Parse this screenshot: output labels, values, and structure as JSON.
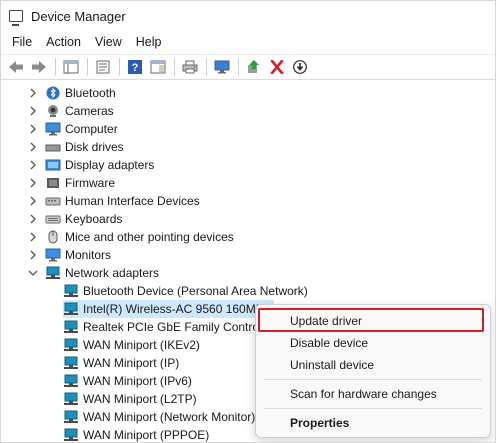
{
  "window": {
    "title": "Device Manager"
  },
  "menubar": {
    "items": [
      "File",
      "Action",
      "View",
      "Help"
    ]
  },
  "toolbar": {
    "buttons": [
      "back-arrow-icon",
      "forward-arrow-icon",
      "show-hide-tree-icon",
      "properties-icon",
      "help-icon",
      "action-pane-icon",
      "print-icon",
      "computer-monitor-icon",
      "update-driver-icon",
      "uninstall-x-icon",
      "download-icon"
    ]
  },
  "tree": {
    "categories": [
      {
        "label": "Bluetooth",
        "icon": "bluetooth-icon",
        "expanded": false
      },
      {
        "label": "Cameras",
        "icon": "camera-icon",
        "expanded": false
      },
      {
        "label": "Computer",
        "icon": "computer-icon",
        "expanded": false
      },
      {
        "label": "Disk drives",
        "icon": "disk-drive-icon",
        "expanded": false
      },
      {
        "label": "Display adapters",
        "icon": "display-adapter-icon",
        "expanded": false
      },
      {
        "label": "Firmware",
        "icon": "firmware-icon",
        "expanded": false
      },
      {
        "label": "Human Interface Devices",
        "icon": "hid-icon",
        "expanded": false
      },
      {
        "label": "Keyboards",
        "icon": "keyboard-icon",
        "expanded": false
      },
      {
        "label": "Mice and other pointing devices",
        "icon": "mouse-icon",
        "expanded": false
      },
      {
        "label": "Monitors",
        "icon": "monitor-icon",
        "expanded": false
      },
      {
        "label": "Network adapters",
        "icon": "network-adapter-icon",
        "expanded": true
      }
    ],
    "network_children": [
      {
        "label": "Bluetooth Device (Personal Area Network)"
      },
      {
        "label": "Intel(R) Wireless-AC 9560 160MHz"
      },
      {
        "label": "Realtek PCIe GbE Family Controller"
      },
      {
        "label": "WAN Miniport (IKEv2)"
      },
      {
        "label": "WAN Miniport (IP)"
      },
      {
        "label": "WAN Miniport (IPv6)"
      },
      {
        "label": "WAN Miniport (L2TP)"
      },
      {
        "label": "WAN Miniport (Network Monitor)"
      },
      {
        "label": "WAN Miniport (PPPOE)"
      }
    ]
  },
  "context_menu": {
    "items": [
      "Update driver",
      "Disable device",
      "Uninstall device",
      "Scan for hardware changes",
      "Properties"
    ],
    "highlight_color": "#d21f2a"
  },
  "colors": {
    "selection": "#cde8ff",
    "accent_blue": "#2a7ad5",
    "accent_teal": "#1e8fb8"
  }
}
